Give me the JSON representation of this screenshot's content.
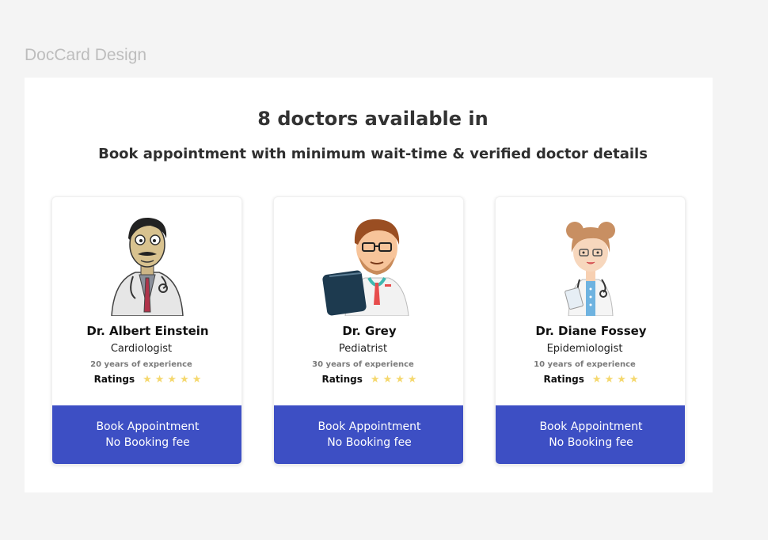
{
  "frame_label": "DocCard Design",
  "headline": "8 doctors available in",
  "subhead": "Book appointment with minimum wait-time & verified doctor details",
  "ratings_label": "Ratings",
  "colors": {
    "button": "#3d4fc4",
    "star": "#f5d86e"
  },
  "doctors": [
    {
      "name": "Dr. Albert Einstein",
      "specialty": "Cardiologist",
      "experience": "20 years of experience",
      "rating": 5,
      "button_line1": "Book Appointment",
      "button_line2": "No Booking fee",
      "avatar_icon": "doctor-einstein-avatar-icon"
    },
    {
      "name": "Dr. Grey",
      "specialty": "Pediatrist",
      "experience": "30 years of experience",
      "rating": 4,
      "button_line1": "Book Appointment",
      "button_line2": "No Booking fee",
      "avatar_icon": "doctor-grey-avatar-icon"
    },
    {
      "name": "Dr. Diane  Fossey",
      "specialty": "Epidemiologist",
      "experience": "10 years of experience",
      "rating": 4,
      "button_line1": "Book Appointment",
      "button_line2": "No Booking fee",
      "avatar_icon": "doctor-fossey-avatar-icon"
    }
  ]
}
